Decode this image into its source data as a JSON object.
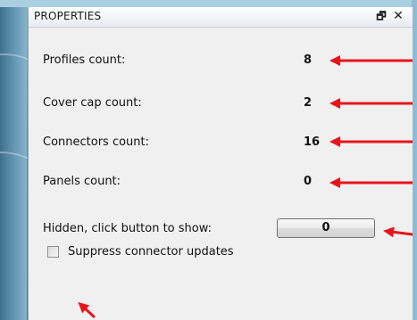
{
  "panel": {
    "title": "PROPERTIES",
    "dock_icon": "restore-window-icon",
    "close_icon": "close-icon"
  },
  "stats": [
    {
      "label": "Profiles count:",
      "value": "8"
    },
    {
      "label": "Cover cap count:",
      "value": "2"
    },
    {
      "label": "Connectors count:",
      "value": "16"
    },
    {
      "label": "Panels count:",
      "value": "0"
    }
  ],
  "hidden": {
    "label": "Hidden, click button to show:",
    "button_value": "0"
  },
  "suppress": {
    "label": "Suppress connector updates",
    "checked": false
  },
  "annotation": {
    "arrow_color": "#e8141b"
  }
}
